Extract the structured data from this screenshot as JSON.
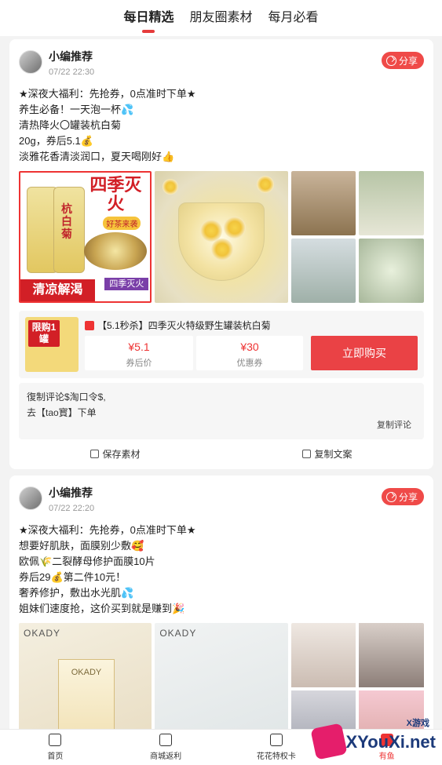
{
  "tabs": [
    {
      "label": "每日精选",
      "active": true
    },
    {
      "label": "朋友圈素材",
      "active": false
    },
    {
      "label": "每月必看",
      "active": false
    }
  ],
  "posts": [
    {
      "author": "小编推荐",
      "time": "07/22 22:30",
      "share_label": "分享",
      "lines": [
        "★深夜大福利：先抢券，0点准时下单★",
        "养生必备！一天泡一杯💦",
        "清热降火〇罐装杭白菊",
        "20g，券后5.1💰",
        "淡雅花香清淡润口，夏天喝刚好👍"
      ],
      "image1": {
        "title": "四季灭火",
        "pill": "好茶来袭",
        "jar_label": "杭白菊",
        "banner": "清凉解渴",
        "banner2": "四季灭火"
      },
      "product": {
        "title": "【5.1秒杀】四季灭火特级野生罐装杭白菊",
        "thumb_badge": "限购1罐",
        "coupon_price": "¥5.1",
        "coupon_price_label": "券后价",
        "coupon_value": "¥30",
        "coupon_value_label": "优惠券",
        "buy_label": "立即购买"
      },
      "comment": {
        "line1": "復制评论$淘口令$,",
        "line2": "去【tao寳】下单",
        "copy_label": "复制评论"
      },
      "actions": {
        "save": "保存素材",
        "copy": "复制文案"
      }
    },
    {
      "author": "小编推荐",
      "time": "07/22 22:20",
      "share_label": "分享",
      "lines": [
        "★深夜大福利：先抢券，0点准时下单★",
        "想要好肌肤，面膜别少敷🥰",
        "欧佩🌾二裂酵母修护面膜10片",
        "券后29💰第二件10元！",
        "奢养修护，敷出水光肌💦",
        "姐妹们速度抢，这价买到就是赚到🎉"
      ],
      "image_brand": "OKADY"
    }
  ],
  "tabbar": [
    {
      "label": "首页",
      "icon": "home-icon",
      "active": false
    },
    {
      "label": "商城返利",
      "icon": "robot-icon",
      "active": false
    },
    {
      "label": "花花特权卡",
      "icon": "gift-icon",
      "active": false
    },
    {
      "label": "有鱼",
      "icon": "fish-icon",
      "active": true
    }
  ],
  "watermark": {
    "brand": "XYouXi.net",
    "top": "X游戏"
  },
  "colors": {
    "accent": "#e53b3b",
    "buy_button": "#ea4245",
    "background": "#f3f3f3"
  }
}
